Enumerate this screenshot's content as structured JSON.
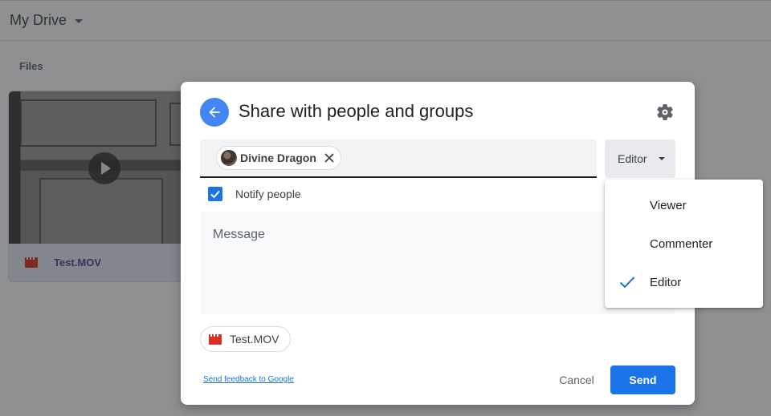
{
  "background": {
    "drive_title": "My Drive",
    "section_label": "Files",
    "file": {
      "name": "Test.MOV",
      "type_icon": "video-file-icon",
      "thumbnail_icon": "play-icon"
    }
  },
  "dialog": {
    "title": "Share with people and groups",
    "back_icon": "arrow-back-icon",
    "settings_icon": "gear-icon",
    "recipients": [
      {
        "name": "Divine Dragon",
        "remove_icon": "close-icon"
      }
    ],
    "role_button": {
      "label": "Editor",
      "icon": "caret-down-icon"
    },
    "notify": {
      "label": "Notify people",
      "checked": true
    },
    "message": {
      "placeholder": "Message",
      "value": ""
    },
    "attachment": {
      "name": "Test.MOV",
      "icon": "video-file-icon"
    },
    "feedback_link": "Send feedback to Google",
    "cancel_label": "Cancel",
    "send_label": "Send",
    "colors": {
      "accent": "#1a73e8",
      "back_button": "#4285f4",
      "file_icon": "#d93025"
    }
  },
  "role_menu": {
    "items": [
      {
        "label": "Viewer",
        "selected": false
      },
      {
        "label": "Commenter",
        "selected": false
      },
      {
        "label": "Editor",
        "selected": true
      }
    ],
    "selected_icon": "check-icon"
  }
}
